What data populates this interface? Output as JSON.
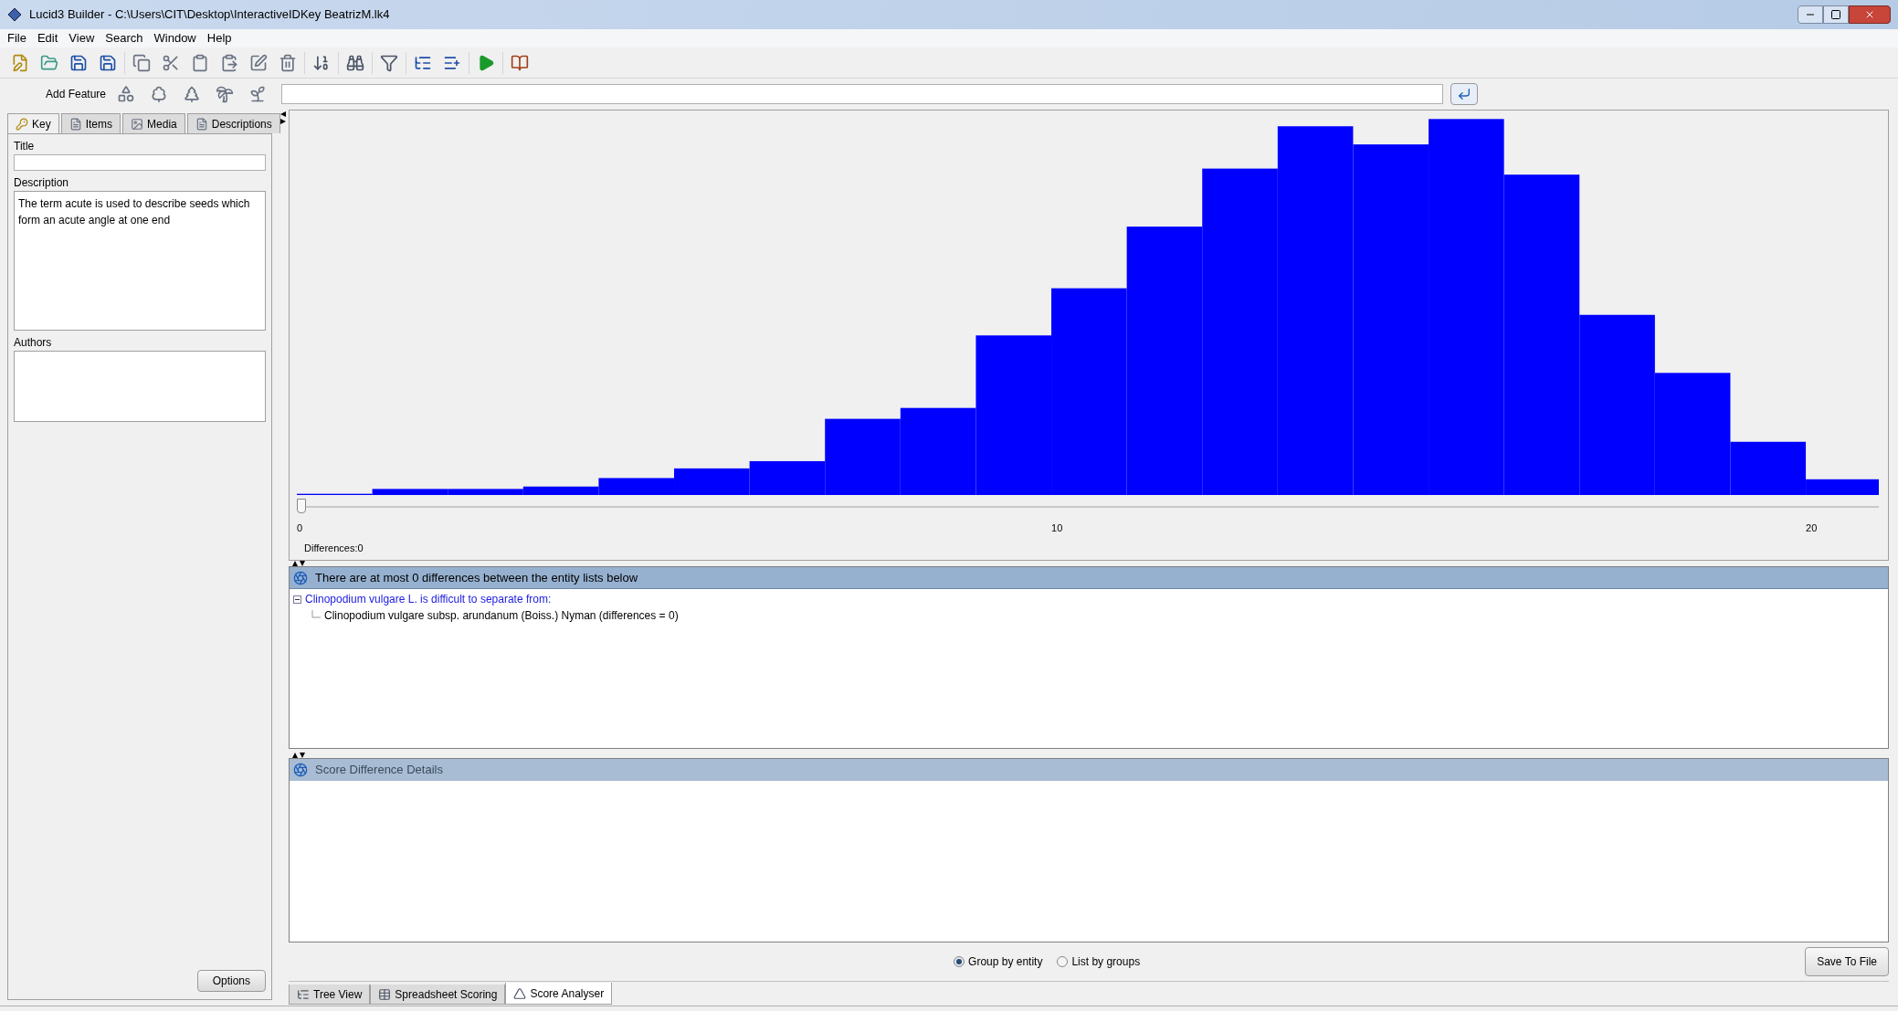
{
  "window": {
    "title": "Lucid3 Builder - C:\\Users\\CIT\\Desktop\\InteractiveIDKey BeatrizM.lk4"
  },
  "menu": [
    "File",
    "Edit",
    "View",
    "Search",
    "Window",
    "Help"
  ],
  "add_feature": {
    "label": "Add Feature"
  },
  "left_panel": {
    "tabs": [
      {
        "label": "Key",
        "selected": true
      },
      {
        "label": "Items",
        "selected": false
      },
      {
        "label": "Media",
        "selected": false
      },
      {
        "label": "Descriptions",
        "selected": false
      }
    ],
    "title_label": "Title",
    "description_label": "Description",
    "description": "The term acute is used to describe seeds which form an acute angle at one end",
    "authors_label": "Authors",
    "options_button": "Options"
  },
  "histogram": {
    "x_ticks": [
      "0",
      "10",
      "20"
    ],
    "slider": {
      "level": 0
    },
    "differences": "Differences:0"
  },
  "entity_panel": {
    "header": "There are at most 0 differences between the entity lists below",
    "tree": [
      {
        "text": "Clinopodium vulgare L. is difficult to separate from:",
        "expanded": true,
        "children": [
          {
            "text": "Clinopodium vulgare subsp. arundanum (Boiss.) Nyman (differences = 0)"
          }
        ]
      }
    ]
  },
  "score_panel": {
    "header": "Score Difference Details"
  },
  "grouping": [
    {
      "label": "Group by entity",
      "selected": true
    },
    {
      "label": "List by groups",
      "selected": false
    }
  ],
  "save_button": "Save To File",
  "bottom_tabs": [
    {
      "label": "Tree View",
      "selected": false
    },
    {
      "label": "Spreadsheet Scoring",
      "selected": false
    },
    {
      "label": "Score Analyser",
      "selected": true
    }
  ]
}
